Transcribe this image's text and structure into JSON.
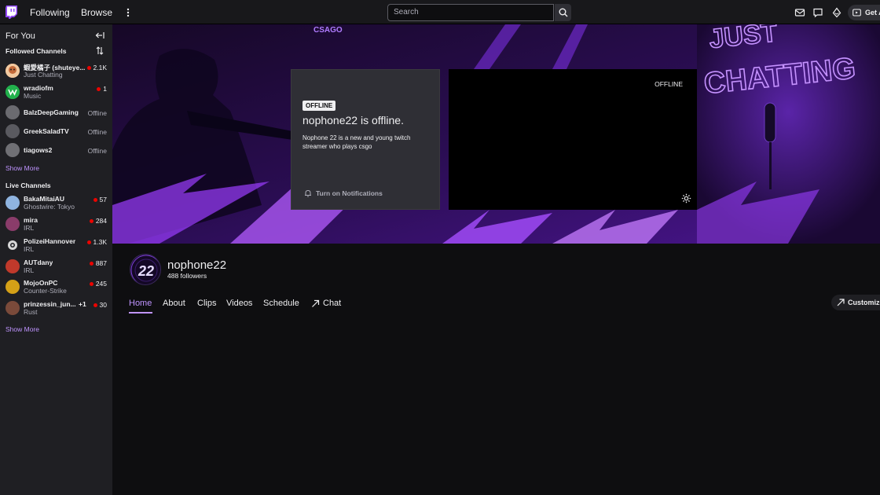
{
  "topbar": {
    "following": "Following",
    "browse": "Browse",
    "search_placeholder": "Search",
    "get_ad_free": "Get A"
  },
  "sidebar": {
    "for_you": "For You",
    "followed_channels": "Followed Channels",
    "live_channels": "Live Channels",
    "show_more": "Show More",
    "followed": [
      {
        "name": "蝦愛橘子 (shuteye...",
        "game": "Just Chatting",
        "viewers": "2.1K",
        "live": true
      },
      {
        "name": "wradiofm",
        "game": "Music",
        "viewers": "1",
        "live": true
      },
      {
        "name": "BalzDeepGaming",
        "game": "",
        "status": "Offline",
        "live": false
      },
      {
        "name": "GreekSaladTV",
        "game": "",
        "status": "Offline",
        "live": false
      },
      {
        "name": "tiagows2",
        "game": "",
        "status": "Offline",
        "live": false
      }
    ],
    "live": [
      {
        "name": "BakaMitaiAU",
        "game": "Ghostwire: Tokyo",
        "viewers": "57"
      },
      {
        "name": "mira",
        "game": "IRL",
        "viewers": "284"
      },
      {
        "name": "PolizeiHannover",
        "game": "IRL",
        "viewers": "1.3K"
      },
      {
        "name": "AUTdany",
        "game": "IRL",
        "viewers": "887"
      },
      {
        "name": "MojoOnPC",
        "game": "Counter-Strike",
        "viewers": "245"
      },
      {
        "name": "prinzessin_jun...",
        "game": "Rust",
        "viewers": "30",
        "extra": "+1"
      }
    ]
  },
  "banner": {
    "offline_badge": "OFFLINE",
    "offline_title": "nophone22 is offline.",
    "description": "Nophone 22 is a new and young twitch streamer who plays csgo",
    "notifications": "Turn on Notifications",
    "video_status": "OFFLINE",
    "art_text_left": "CSAGO",
    "art_text_right_1": "JUST",
    "art_text_right_2": "CHATTING"
  },
  "channel": {
    "name": "nophone22",
    "followers": "488 followers",
    "avatar_text": "22",
    "tabs": [
      "Home",
      "About",
      "Clips",
      "Videos",
      "Schedule",
      "Chat"
    ],
    "customize": "Customize"
  },
  "colors": {
    "accent": "#bf94ff",
    "live": "#eb0400",
    "background": "#0e0e10"
  }
}
